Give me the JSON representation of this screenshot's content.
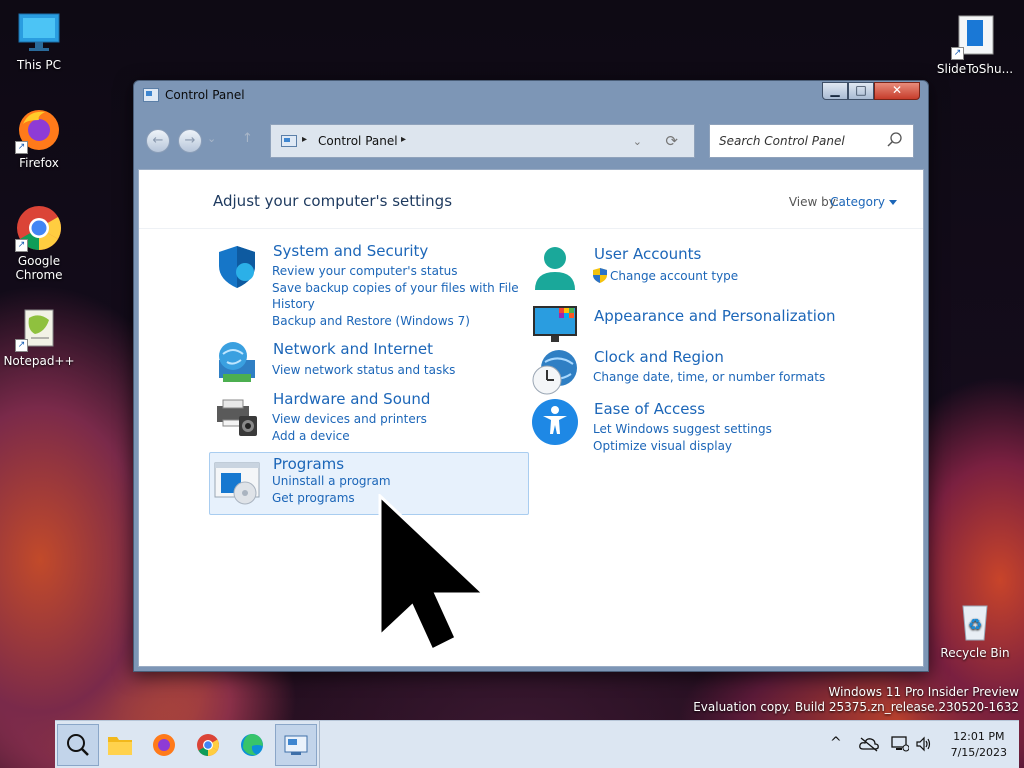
{
  "desktop": {
    "icons": [
      {
        "label": "This PC"
      },
      {
        "label": "Firefox"
      },
      {
        "label": "Google Chrome"
      },
      {
        "label": "Notepad++"
      },
      {
        "label": "SlideToShu..."
      },
      {
        "label": "Recycle Bin"
      }
    ],
    "watermark": {
      "line1": "Windows 11 Pro Insider Preview",
      "line2": "Evaluation copy. Build 25375.zn_release.230520-1632"
    }
  },
  "window": {
    "title": "Control Panel",
    "buttons": {
      "minimize": "▁",
      "maximize": "□",
      "close": "✕"
    }
  },
  "toolbar": {
    "back_icon": "←",
    "forward_icon": "→",
    "recent_icon": "⌄",
    "up_icon": "↑",
    "address": {
      "crumb": "Control Panel",
      "sep": "▸",
      "dropdown": "⌄",
      "refresh": "⟳"
    },
    "search": {
      "placeholder": "Search Control Panel"
    }
  },
  "content": {
    "heading": "Adjust your computer's settings",
    "view_by_label": "View by:",
    "view_by_value": "Category",
    "categories": [
      {
        "title": "System and Security",
        "icon": "shield-icon",
        "links": [
          "Review your computer's status",
          "Save backup copies of your files with File",
          "History",
          "Backup and Restore (Windows 7)"
        ]
      },
      {
        "title": "Network and Internet",
        "icon": "globe-network-icon",
        "links": [
          "View network status and tasks"
        ]
      },
      {
        "title": "Hardware and Sound",
        "icon": "printer-speaker-icon",
        "links": [
          "View devices and printers",
          "Add a device"
        ]
      },
      {
        "title": "Programs",
        "icon": "programs-icon",
        "links": [
          "Uninstall a program",
          "Get programs"
        ]
      },
      {
        "title": "User Accounts",
        "icon": "user-icon",
        "links": [
          "Change account type"
        ]
      },
      {
        "title": "Appearance and Personalization",
        "icon": "monitor-palette-icon",
        "links": []
      },
      {
        "title": "Clock and Region",
        "icon": "clock-globe-icon",
        "links": [
          "Change date, time, or number formats"
        ]
      },
      {
        "title": "Ease of Access",
        "icon": "accessibility-icon",
        "links": [
          "Let Windows suggest settings",
          "Optimize visual display"
        ]
      }
    ]
  },
  "taskbar": {
    "items": [
      "search-icon",
      "file-explorer-icon",
      "firefox-icon",
      "chrome-icon",
      "edge-icon",
      "control-panel-icon"
    ],
    "tray": {
      "chevron": "^"
    },
    "clock": {
      "time": "12:01 PM",
      "date": "7/15/2023"
    }
  },
  "colors": {
    "link": "#1c66b8",
    "window_frame": "#7d96b6",
    "taskbar": "#dce6f2",
    "highlight_bg": "#e7f1fc"
  }
}
